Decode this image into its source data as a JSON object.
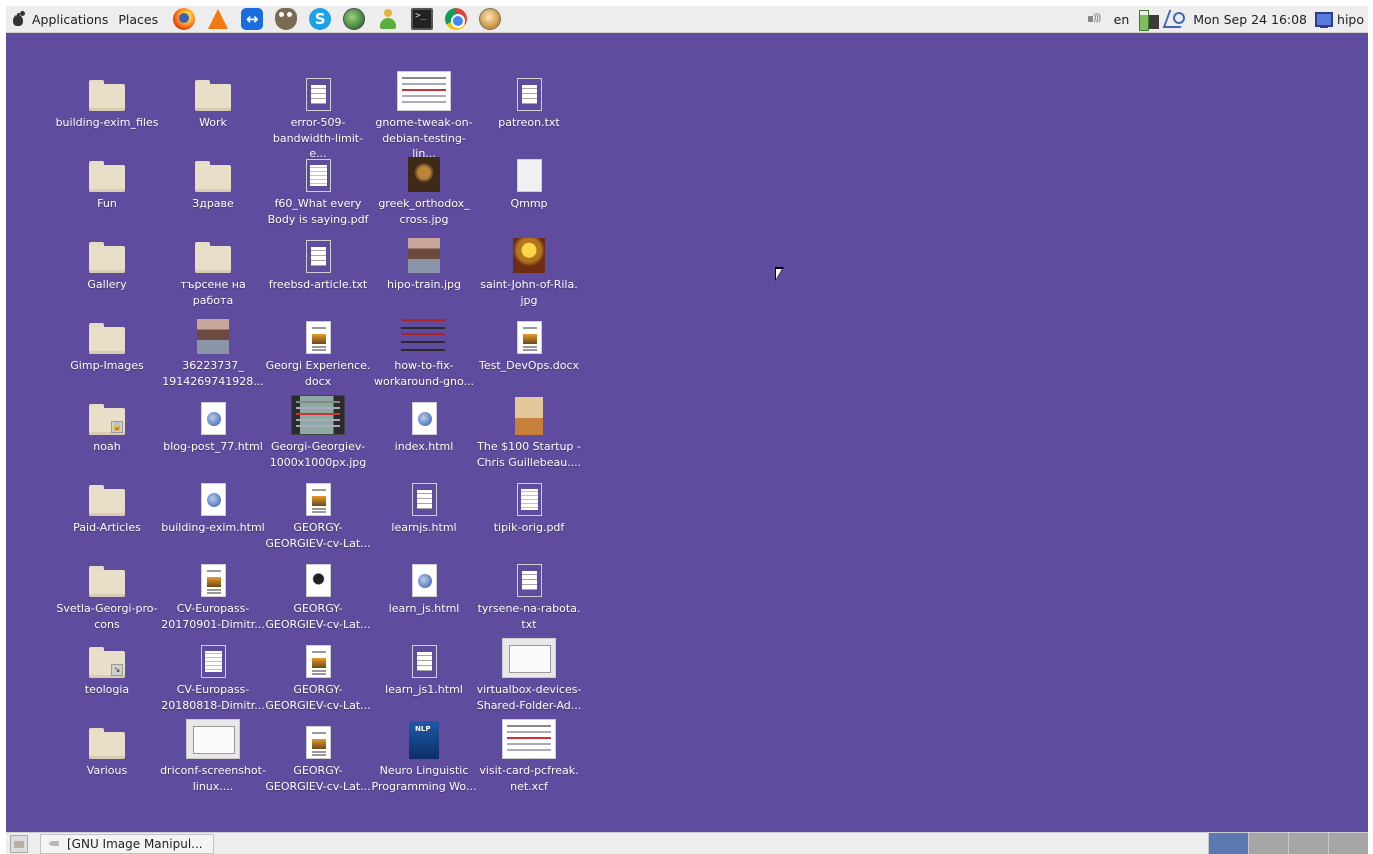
{
  "top_panel": {
    "applications": "Applications",
    "places": "Places",
    "launchers": [
      "firefox-icon",
      "vlc-icon",
      "teamviewer-icon",
      "gimp-icon",
      "skype-icon",
      "globe-icon",
      "contacts-icon",
      "terminal-icon",
      "chrome-icon",
      "pidgin-icon"
    ],
    "keyboard_layout": "en",
    "clock": "Mon Sep 24  16:08",
    "user": "hipo"
  },
  "desktop": {
    "background_color": "#5f4c9e",
    "icons": {
      "c1": [
        {
          "label": "building-exim_files",
          "kind": "folder"
        },
        {
          "label": "Fun",
          "kind": "folder"
        },
        {
          "label": "Gallery",
          "kind": "folder"
        },
        {
          "label": "Gimp-Images",
          "kind": "folder"
        },
        {
          "label": "noah",
          "kind": "folder-locked"
        },
        {
          "label": "Paid-Articles",
          "kind": "folder"
        },
        {
          "label": "Svetla-Georgi-pro-cons",
          "kind": "folder"
        },
        {
          "label": "teologia",
          "kind": "folder-link"
        },
        {
          "label": "Various",
          "kind": "folder"
        }
      ],
      "c2": [
        {
          "label": "Work",
          "kind": "folder"
        },
        {
          "label": "Здраве",
          "kind": "folder"
        },
        {
          "label": "търсене на работа",
          "kind": "folder"
        },
        {
          "label": "36223737_ 1914269741928...",
          "kind": "photo"
        },
        {
          "label": "blog-post_77.html",
          "kind": "html"
        },
        {
          "label": "building-exim.html",
          "kind": "html"
        },
        {
          "label": "CV-Europass-20170901-Dimitr...",
          "kind": "doc-image"
        },
        {
          "label": "CV-Europass-20180818-Dimitr...",
          "kind": "pdf"
        },
        {
          "label": "driconf-screenshot-linux....",
          "kind": "screenshot-dialog"
        }
      ],
      "c3": [
        {
          "label": "error-509-bandwidth-limit-e...",
          "kind": "text"
        },
        {
          "label": "f60_What every Body is saying.pdf",
          "kind": "pdf"
        },
        {
          "label": "freebsd-article.txt",
          "kind": "text"
        },
        {
          "label": "Georgi Experience. docx",
          "kind": "doc-image"
        },
        {
          "label": "Georgi-Georgiev-1000x1000px.jpg",
          "kind": "photo-wide"
        },
        {
          "label": "GEORGY-GEORGIEV-cv-Lat...",
          "kind": "doc-image"
        },
        {
          "label": "GEORGY-GEORGIEV-cv-Lat...",
          "kind": "doc-photo"
        },
        {
          "label": "GEORGY-GEORGIEV-cv-Lat...",
          "kind": "doc-image"
        },
        {
          "label": "GEORGY-GEORGIEV-cv-Lat...",
          "kind": "doc-image"
        }
      ],
      "c4": [
        {
          "label": "gnome-tweak-on-debian-testing-lin...",
          "kind": "screenshot"
        },
        {
          "label": "greek_orthodox_ cross.jpg",
          "kind": "photo-dark"
        },
        {
          "label": "hipo-train.jpg",
          "kind": "photo"
        },
        {
          "label": "how-to-fix-workaround-gno...",
          "kind": "screenshot-bars"
        },
        {
          "label": "index.html",
          "kind": "html"
        },
        {
          "label": "learnjs.html",
          "kind": "text"
        },
        {
          "label": "learn_js.html",
          "kind": "html"
        },
        {
          "label": "learn_js1.html",
          "kind": "text"
        },
        {
          "label": "Neuro Linguistic Programming Wo...",
          "kind": "book-blue"
        }
      ],
      "c5": [
        {
          "label": "patreon.txt",
          "kind": "text"
        },
        {
          "label": "Qmmp",
          "kind": "blank"
        },
        {
          "label": "saint-John-of-Rila. jpg",
          "kind": "icon-gold"
        },
        {
          "label": "Test_DevOps.docx",
          "kind": "doc-image"
        },
        {
          "label": "The $100 Startup - Chris Guillebeau....",
          "kind": "book-bike"
        },
        {
          "label": "tipik-orig.pdf",
          "kind": "pdf"
        },
        {
          "label": "tyrsene-na-rabota. txt",
          "kind": "text"
        },
        {
          "label": "virtualbox-devices-Shared-Folder-Ad...",
          "kind": "screenshot-dialog"
        },
        {
          "label": "visit-card-pcfreak. net.xcf",
          "kind": "screenshot"
        }
      ]
    }
  },
  "bottom_panel": {
    "task_button": "[GNU Image Manipul...",
    "workspaces": 4,
    "active_workspace": 1
  }
}
